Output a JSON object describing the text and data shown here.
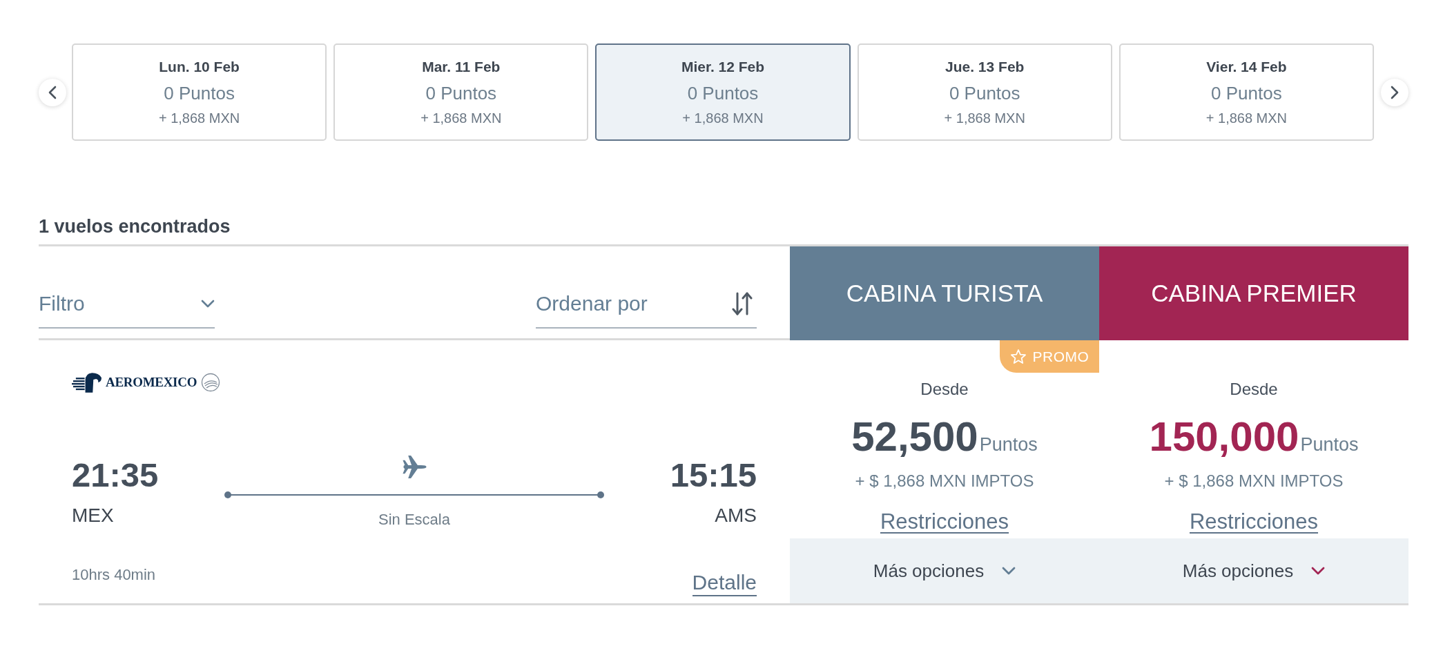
{
  "date_nav": {
    "days": [
      {
        "date": "Lun. 10 Feb",
        "points": "0 Puntos",
        "price": "+ 1,868 MXN",
        "selected": false
      },
      {
        "date": "Mar. 11 Feb",
        "points": "0 Puntos",
        "price": "+ 1,868 MXN",
        "selected": false
      },
      {
        "date": "Mier. 12 Feb",
        "points": "0 Puntos",
        "price": "+ 1,868 MXN",
        "selected": true
      },
      {
        "date": "Jue. 13 Feb",
        "points": "0 Puntos",
        "price": "+ 1,868 MXN",
        "selected": false
      },
      {
        "date": "Vier. 14 Feb",
        "points": "0 Puntos",
        "price": "+ 1,868 MXN",
        "selected": false
      }
    ]
  },
  "results": {
    "count": "1 vuelos encontrados"
  },
  "filter": {
    "label": "Filtro"
  },
  "sort": {
    "label": "Ordenar por"
  },
  "cabins": [
    {
      "name": "CABINA TURISTA",
      "kind": "standard",
      "color": "#637e94"
    },
    {
      "name": "CABINA PREMIER",
      "kind": "premium",
      "color": "#a22553"
    }
  ],
  "flights": [
    {
      "airline": "AEROMEXICO",
      "departure": {
        "time": "21:35",
        "airport": "MEX"
      },
      "arrival": {
        "time": "15:15",
        "airport": "AMS"
      },
      "stops": "Sin Escala",
      "duration": "10hrs 40min",
      "detail_link": "Detalle",
      "fares": [
        {
          "badge": "PROMO",
          "from": "Desde",
          "points": "52,500",
          "unit": "Puntos",
          "taxes": "+ $ 1,868 MXN IMPTOS",
          "restrictions_link": "Restricciones",
          "more_options": {
            "label": "Más opciones",
            "expanded": false
          }
        },
        {
          "from": "Desde",
          "points": "150,000",
          "unit": "Puntos",
          "taxes": "+ $ 1,868 MXN IMPTOS",
          "restrictions_link": "Restricciones",
          "more_options": {
            "label": "Más opciones",
            "expanded": false
          }
        }
      ]
    }
  ]
}
